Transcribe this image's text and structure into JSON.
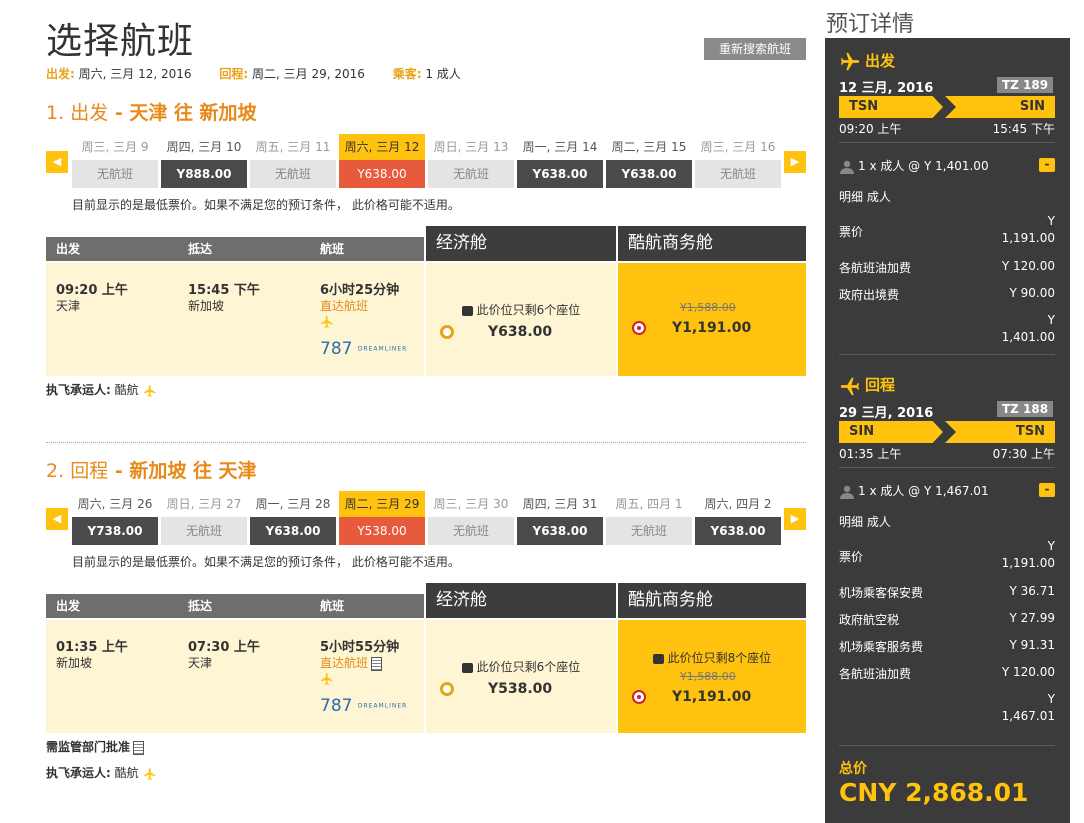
{
  "page_title": "选择航班",
  "new_search_label": "重新搜索航班",
  "summary": {
    "depart_label": "出发:",
    "depart_value": "周六, 三月 12, 2016",
    "return_label": "回程:",
    "return_value": "周二, 三月 29, 2016",
    "pax_label": "乘客:",
    "pax_value": "1 成人"
  },
  "outbound": {
    "num": "1.",
    "kind": "出发",
    "dash": " - ",
    "route": "天津 往 新加坡",
    "dates": [
      {
        "label": "周三, 三月 9",
        "price": "无航班",
        "state": "none"
      },
      {
        "label": "周四, 三月 10",
        "price": "Y888.00",
        "state": "dark"
      },
      {
        "label": "周五, 三月 11",
        "price": "无航班",
        "state": "none"
      },
      {
        "label": "周六, 三月 12",
        "price": "Y638.00",
        "state": "selected"
      },
      {
        "label": "周日, 三月 13",
        "price": "无航班",
        "state": "none"
      },
      {
        "label": "周一, 三月 14",
        "price": "Y638.00",
        "state": "dark"
      },
      {
        "label": "周二, 三月 15",
        "price": "Y638.00",
        "state": "dark"
      },
      {
        "label": "周三, 三月 16",
        "price": "无航班",
        "state": "none"
      }
    ],
    "note": "目前显示的是最低票价。如果不满足您的预订条件， 此价格可能不适用。",
    "head": {
      "depart": "出发",
      "arrive": "抵达",
      "flight": "航班",
      "economy": "经济舱",
      "business": "酷航商务舱"
    },
    "dep_time": "09:20 上午",
    "dep_city": "天津",
    "arr_time": "15:45 下午",
    "arr_city": "新加坡",
    "duration": "6小时25分钟",
    "direct": "直达航班",
    "logo_num": "787",
    "logo_text": "DREAMLINER",
    "eco_seats": "此价位只剩6个座位",
    "eco_price": "Y638.00",
    "biz_old": "Y1,588.00",
    "biz_price": "Y1,191.00",
    "carrier_label": "执飞承运人:",
    "carrier": "酷航"
  },
  "inbound": {
    "num": "2.",
    "kind": "回程",
    "dash": " - ",
    "route": "新加坡 往 天津",
    "dates": [
      {
        "label": "周六, 三月 26",
        "price": "Y738.00",
        "state": "dark"
      },
      {
        "label": "周日, 三月 27",
        "price": "无航班",
        "state": "none"
      },
      {
        "label": "周一, 三月 28",
        "price": "Y638.00",
        "state": "dark"
      },
      {
        "label": "周二, 三月 29",
        "price": "Y538.00",
        "state": "selected"
      },
      {
        "label": "周三, 三月 30",
        "price": "无航班",
        "state": "none"
      },
      {
        "label": "周四, 三月 31",
        "price": "Y638.00",
        "state": "dark"
      },
      {
        "label": "周五, 四月 1",
        "price": "无航班",
        "state": "none"
      },
      {
        "label": "周六, 四月 2",
        "price": "Y638.00",
        "state": "dark"
      }
    ],
    "note": "目前显示的是最低票价。如果不满足您的预订条件， 此价格可能不适用。",
    "head": {
      "depart": "出发",
      "arrive": "抵达",
      "flight": "航班",
      "economy": "经济舱",
      "business": "酷航商务舱"
    },
    "dep_time": "01:35 上午",
    "dep_city": "新加坡",
    "arr_time": "07:30 上午",
    "arr_city": "天津",
    "duration": "5小时55分钟",
    "direct": "直达航班",
    "logo_num": "787",
    "logo_text": "DREAMLINER",
    "eco_seats": "此价位只剩6个座位",
    "eco_price": "Y538.00",
    "biz_seats": "此价位只剩8个座位",
    "biz_old": "Y1,588.00",
    "biz_price": "Y1,191.00",
    "reg_note": "需监管部门批准",
    "carrier_label": "执飞承运人:",
    "carrier": "酷航"
  },
  "sidebar": {
    "title": "预订详情",
    "out": {
      "title": "出发",
      "date": "12 三月, 2016",
      "flight_no": "TZ 189",
      "from": "TSN",
      "to": "SIN",
      "dep": "09:20 上午",
      "arr": "15:45 下午",
      "pax": "1 x 成人 @ Y 1,401.00",
      "collapse": "-",
      "pax_type": "明细 成人",
      "fare_label": "票价",
      "fare_cur": "Y",
      "fare_amt": "1,191.00",
      "rows": [
        {
          "label": "各航班油加费",
          "amt": "Y 120.00"
        },
        {
          "label": "政府出境费",
          "amt": "Y 90.00"
        }
      ],
      "sub_cur": "Y",
      "sub_amt": "1,401.00"
    },
    "ret": {
      "title": "回程",
      "date": "29 三月, 2016",
      "flight_no": "TZ 188",
      "from": "SIN",
      "to": "TSN",
      "dep": "01:35 上午",
      "arr": "07:30 上午",
      "pax": "1 x 成人 @ Y 1,467.01",
      "collapse": "-",
      "pax_type": "明细 成人",
      "fare_label": "票价",
      "fare_cur": "Y",
      "fare_amt": "1,191.00",
      "rows": [
        {
          "label": "机场乘客保安费",
          "amt": "Y 36.71"
        },
        {
          "label": "政府航空税",
          "amt": "Y 27.99"
        },
        {
          "label": "机场乘客服务费",
          "amt": "Y 91.31"
        },
        {
          "label": "各航班油加费",
          "amt": "Y 120.00"
        }
      ],
      "sub_cur": "Y",
      "sub_amt": "1,467.01"
    },
    "total_label": "总价",
    "total": "CNY 2,868.01"
  },
  "colors": {
    "accent": "#ffc20e",
    "orange": "#e88a1a",
    "selected_price": "#e85a3c",
    "dark": "#3b3b3b"
  }
}
